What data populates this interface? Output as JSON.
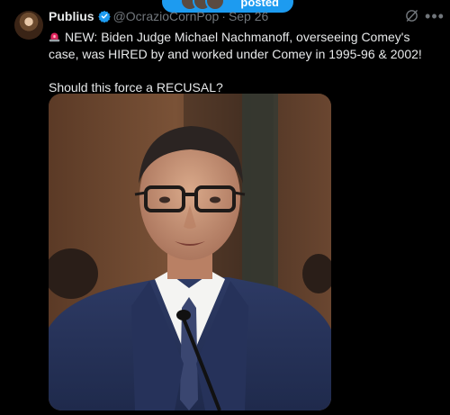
{
  "posted_banner": {
    "label": "posted"
  },
  "author": {
    "name": "Publius",
    "handle": "@OcrazioCornPop",
    "separator": "·",
    "time": "Sep 26"
  },
  "tweet": {
    "line1": "NEW: Biden Judge Michael Nachmanoff, overseeing Comey's case, was HIRED by and worked under Comey in 1995-96 & 2002!",
    "line2": "Should this force a RECUSAL?"
  },
  "icons": {
    "verified": "verified-badge-icon",
    "siren": "siren-emoji-icon",
    "grok": "grok-icon",
    "more": "more-options-icon"
  },
  "colors": {
    "accent": "#1d9bf0",
    "background": "#000000",
    "text": "#e7e9ea",
    "muted": "#71767b"
  },
  "media": {
    "type": "photo",
    "subject": "man in suit and glasses at hearing microphone"
  }
}
